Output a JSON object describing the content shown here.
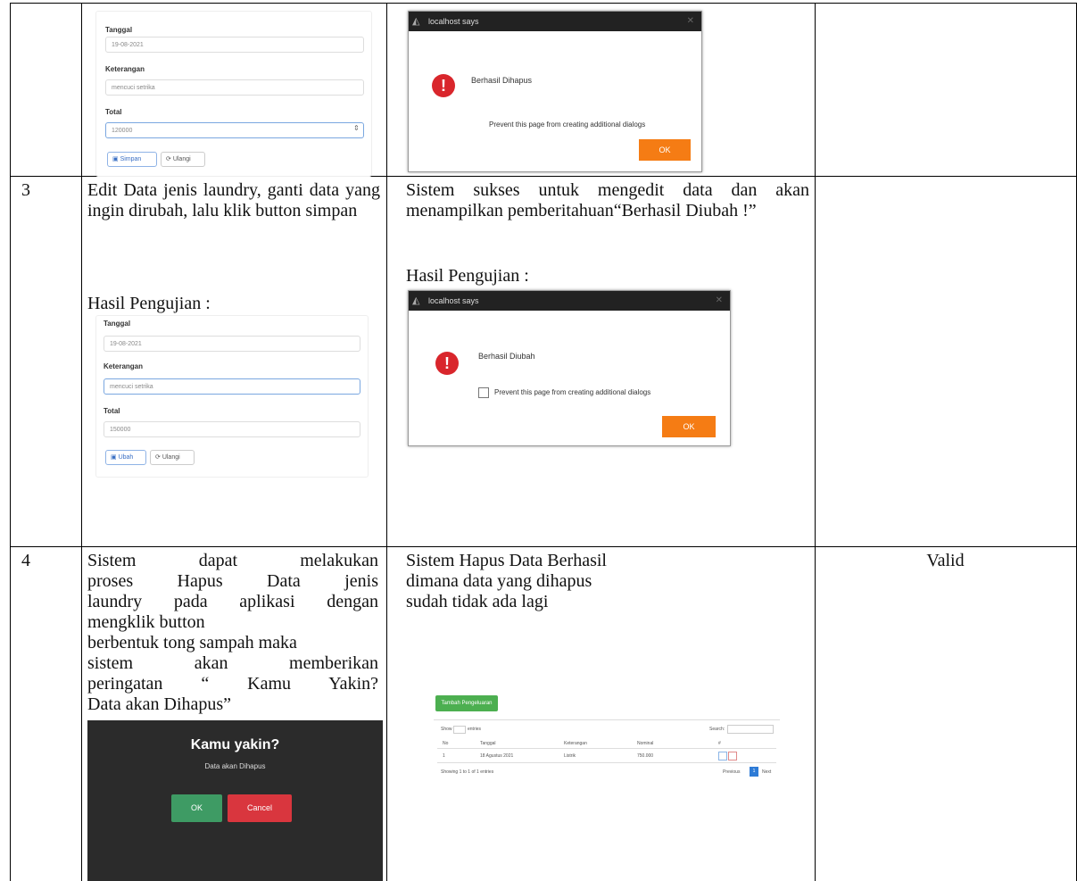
{
  "top_row": {
    "form": {
      "fields": [
        {
          "label": "Tanggal",
          "value": "19-08-2021"
        },
        {
          "label": "Keterangan",
          "value": "mencuci setrika"
        },
        {
          "label": "Total",
          "value": "120000"
        }
      ],
      "buttons": [
        "Simpan",
        "Ulangi"
      ]
    },
    "dialog": {
      "title": "localhost says",
      "message": "Berhasil Dihapus",
      "checkbox_label": "Prevent this page from creating additional dialogs",
      "ok_label": "OK"
    }
  },
  "row3": {
    "no": "3",
    "step_text": "Edit Data jenis laundry, ganti data yang ingin dirubah, lalu klik button simpan",
    "step_result_label": "Hasil Pengujian :",
    "expected_text": "Sistem sukses untuk mengedit data dan akan menampilkan pemberitahuan“Berhasil Diubah !”",
    "expected_result_label": "Hasil Pengujian :",
    "form": {
      "fields": [
        {
          "label": "Tanggal",
          "value": "19-08-2021"
        },
        {
          "label": "Keterangan",
          "value": "mencuci setrika"
        },
        {
          "label": "Total",
          "value": "150000"
        }
      ],
      "buttons": [
        "Ubah",
        "Ulangi"
      ]
    },
    "dialog": {
      "title": "localhost says",
      "message": "Berhasil Diubah",
      "checkbox_label": "Prevent this page from creating additional dialogs",
      "ok_label": "OK"
    }
  },
  "row4": {
    "no": "4",
    "step_lines": [
      "Sistem dapat melakukan",
      "proses Hapus Data jenis",
      "laundry pada aplikasi dengan",
      "mengklik button",
      "berbentuk tong sampah maka",
      "sistem akan memberikan",
      "peringatan “ Kamu Yakin?",
      "Data akan Dihapus”"
    ],
    "expected_lines": [
      "Sistem Hapus Data Berhasil",
      "dimana data yang dihapus",
      "sudah tidak ada lagi"
    ],
    "status": "Valid",
    "swal": {
      "title": "Kamu yakin?",
      "text": "Data akan Dihapus",
      "ok_label": "OK",
      "cancel_label": "Cancel"
    },
    "table_shot": {
      "add_button": "Tambah Pengeluaran",
      "show_label": "Show",
      "entries_label": "entries",
      "search_label": "Search:",
      "headers": [
        "No",
        "Tanggal",
        "Keterangan",
        "Nominal",
        "#"
      ],
      "row": [
        "1",
        "18 Agustus 2021",
        "Listrik",
        "750.000"
      ],
      "footer": "Showing 1 to 1 of 1 entries",
      "prev": "Previous",
      "page": "1",
      "next": "Next"
    }
  },
  "colors": {
    "ok_orange": "#f57c14",
    "error_red": "#d9262c",
    "swal_ok": "#3e9b64",
    "swal_cancel": "#d9363e",
    "add_green": "#4caf50"
  }
}
